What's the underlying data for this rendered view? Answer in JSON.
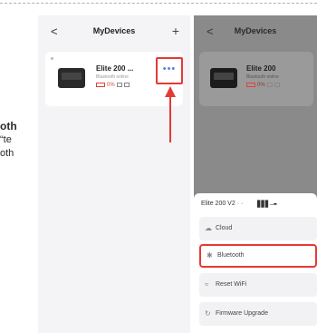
{
  "instructions": {
    "line1": "oth",
    "line2": "te“",
    "line3": "oth"
  },
  "left_screen": {
    "header": {
      "back": "<",
      "title": "MyDevices",
      "add": "+"
    },
    "device": {
      "name": "Elite 200 ...",
      "subtitle": "Bluetooth online",
      "battery": "0%"
    },
    "more_button": "•••"
  },
  "right_screen": {
    "header": {
      "back": "<",
      "title": "MyDevices"
    },
    "device": {
      "name": "Elite 200",
      "subtitle": "Bluetooth online",
      "battery": "0%"
    },
    "sheet": {
      "title": "Elite 200 V2 · ·",
      "signal": "▋▋▋ – ▪▪",
      "options": [
        {
          "icon": "☁",
          "label": "Cloud"
        },
        {
          "icon": "✱",
          "label": "Bluetooth"
        },
        {
          "icon": "≈",
          "label": "Reset WiFi"
        },
        {
          "icon": "↻",
          "label": "Firmware Upgrade"
        }
      ]
    }
  },
  "colors": {
    "highlight": "#e53935",
    "accent": "#5b7fd6"
  }
}
